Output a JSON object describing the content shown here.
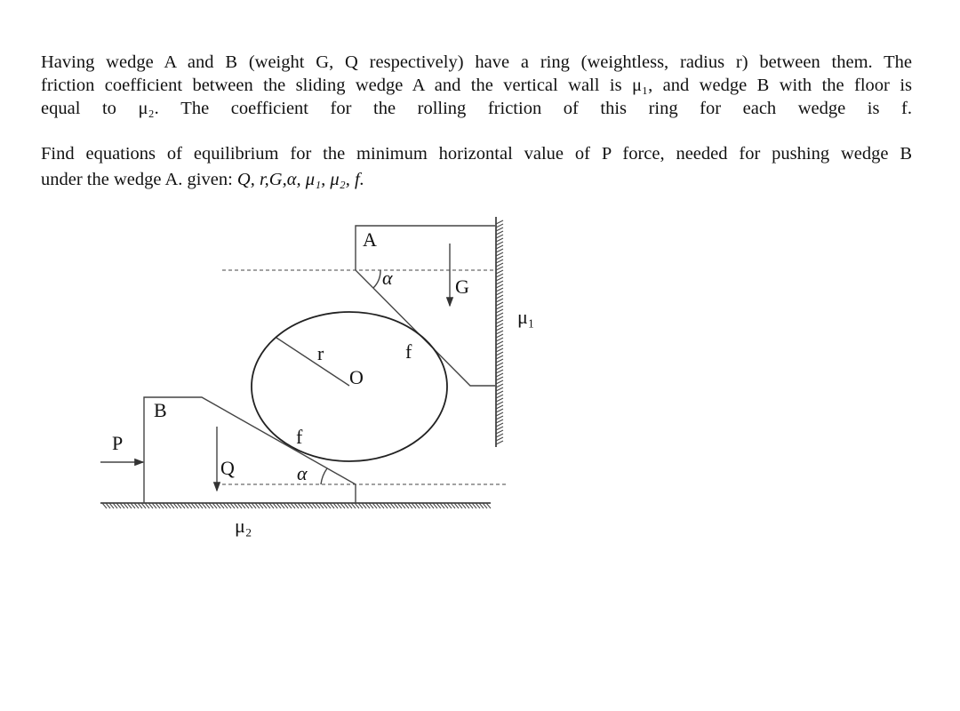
{
  "problem": {
    "paragraph1": [
      "Having wedge A and B  (weight G, Q respectively) have a ring (weightless, radius r) between them. The",
      "friction coefficient between the sliding wedge A and the vertical wall is μ₁, and wedge B with the floor is",
      "equal to μ₂. The coefficient for the rolling friction of this ring for each wedge is f."
    ],
    "paragraph2": [
      "Find equations of equilibrium for the minimum horizontal value of P force, needed for pushing wedge B",
      "under the wedge A. given: "
    ],
    "given_values": "Q, r,G,α, μ₁, μ₂, f."
  },
  "diagram": {
    "labels": {
      "wedge_a": "A",
      "wedge_b": "B",
      "weight_a": "G",
      "weight_b": "Q",
      "force": "P",
      "radius": "r",
      "center": "O",
      "rolling_friction_top": "f",
      "rolling_friction_bottom": "f",
      "angle_top": "α",
      "angle_bottom": "α",
      "wall_friction": "μ₁",
      "floor_friction": "μ₂"
    }
  }
}
